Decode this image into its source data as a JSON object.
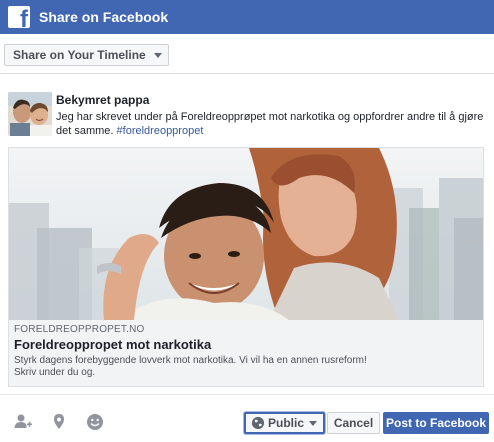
{
  "header": {
    "title": "Share on Facebook",
    "logo_icon": "facebook-logo-icon"
  },
  "toolbar": {
    "destination_label": "Share on Your Timeline"
  },
  "post": {
    "author": "Bekymret pappa",
    "message": "Jeg har skrevet under på Foreldreopprøpet mot narkotika og oppfordrer andre til å gjøre det samme.",
    "hashtag": "#foreldreoppropet"
  },
  "card": {
    "domain": "FORELDREOPPROPET.NO",
    "title": "Foreldreoppropet mot narkotika",
    "description_line1": "Styrk dagens forebyggende lovverk mot narkotika. Vi vil ha en annen rusreform!",
    "description_line2": "Skriv under du og."
  },
  "footer": {
    "privacy_label": "Public",
    "cancel_label": "Cancel",
    "post_label": "Post to Facebook",
    "icons": [
      "tag-friends-icon",
      "location-pin-icon",
      "feeling-smiley-icon"
    ]
  },
  "colors": {
    "brand": "#4267b2",
    "link": "#365899"
  }
}
